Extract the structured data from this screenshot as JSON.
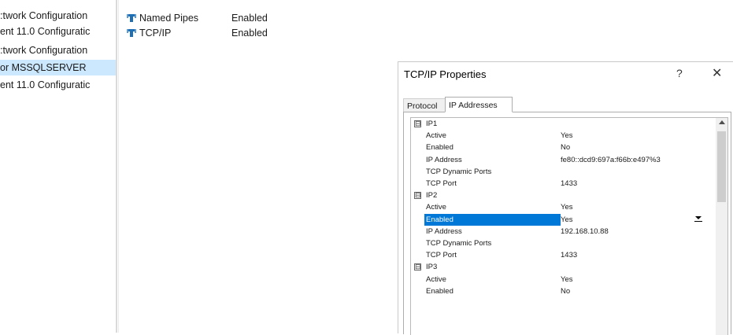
{
  "tree": {
    "items": [
      {
        "label": ":twork Configuration"
      },
      {
        "label": "ent 11.0 Configuratic"
      },
      {
        "label": ":twork Configuration"
      },
      {
        "label": "or MSSQLSERVER"
      },
      {
        "label": "ent 11.0 Configuratic"
      }
    ]
  },
  "protocols": [
    {
      "name": "Named Pipes",
      "status": "Enabled",
      "icon": "protocol-icon"
    },
    {
      "name": "TCP/IP",
      "status": "Enabled",
      "icon": "protocol-icon"
    }
  ],
  "dialog": {
    "title": "TCP/IP Properties",
    "help": "?",
    "close": "✕",
    "tabs": [
      {
        "label": "Protocol"
      },
      {
        "label": "IP Addresses"
      }
    ],
    "rows": [
      {
        "label": "IP1",
        "value": "",
        "group": true,
        "exp": "⊟"
      },
      {
        "label": "Active",
        "value": "Yes"
      },
      {
        "label": "Enabled",
        "value": "No"
      },
      {
        "label": "IP Address",
        "value": "fe80::dcd9:697a:f66b:e497%3"
      },
      {
        "label": "TCP Dynamic Ports",
        "value": ""
      },
      {
        "label": "TCP Port",
        "value": "1433"
      },
      {
        "label": "IP2",
        "value": "",
        "group": true,
        "exp": "⊟"
      },
      {
        "label": "Active",
        "value": "Yes"
      },
      {
        "label": "Enabled",
        "value": "Yes",
        "selected": true
      },
      {
        "label": "IP Address",
        "value": "192.168.10.88"
      },
      {
        "label": "TCP Dynamic Ports",
        "value": ""
      },
      {
        "label": "TCP Port",
        "value": "1433"
      },
      {
        "label": "IP3",
        "value": "",
        "group": true,
        "exp": "⊟"
      },
      {
        "label": "Active",
        "value": "Yes"
      },
      {
        "label": "Enabled",
        "value": "No"
      }
    ]
  },
  "colors": {
    "selection": "#0078d7",
    "tree_selection": "#cce8ff",
    "protocol_icon": "#1f6fb5"
  }
}
